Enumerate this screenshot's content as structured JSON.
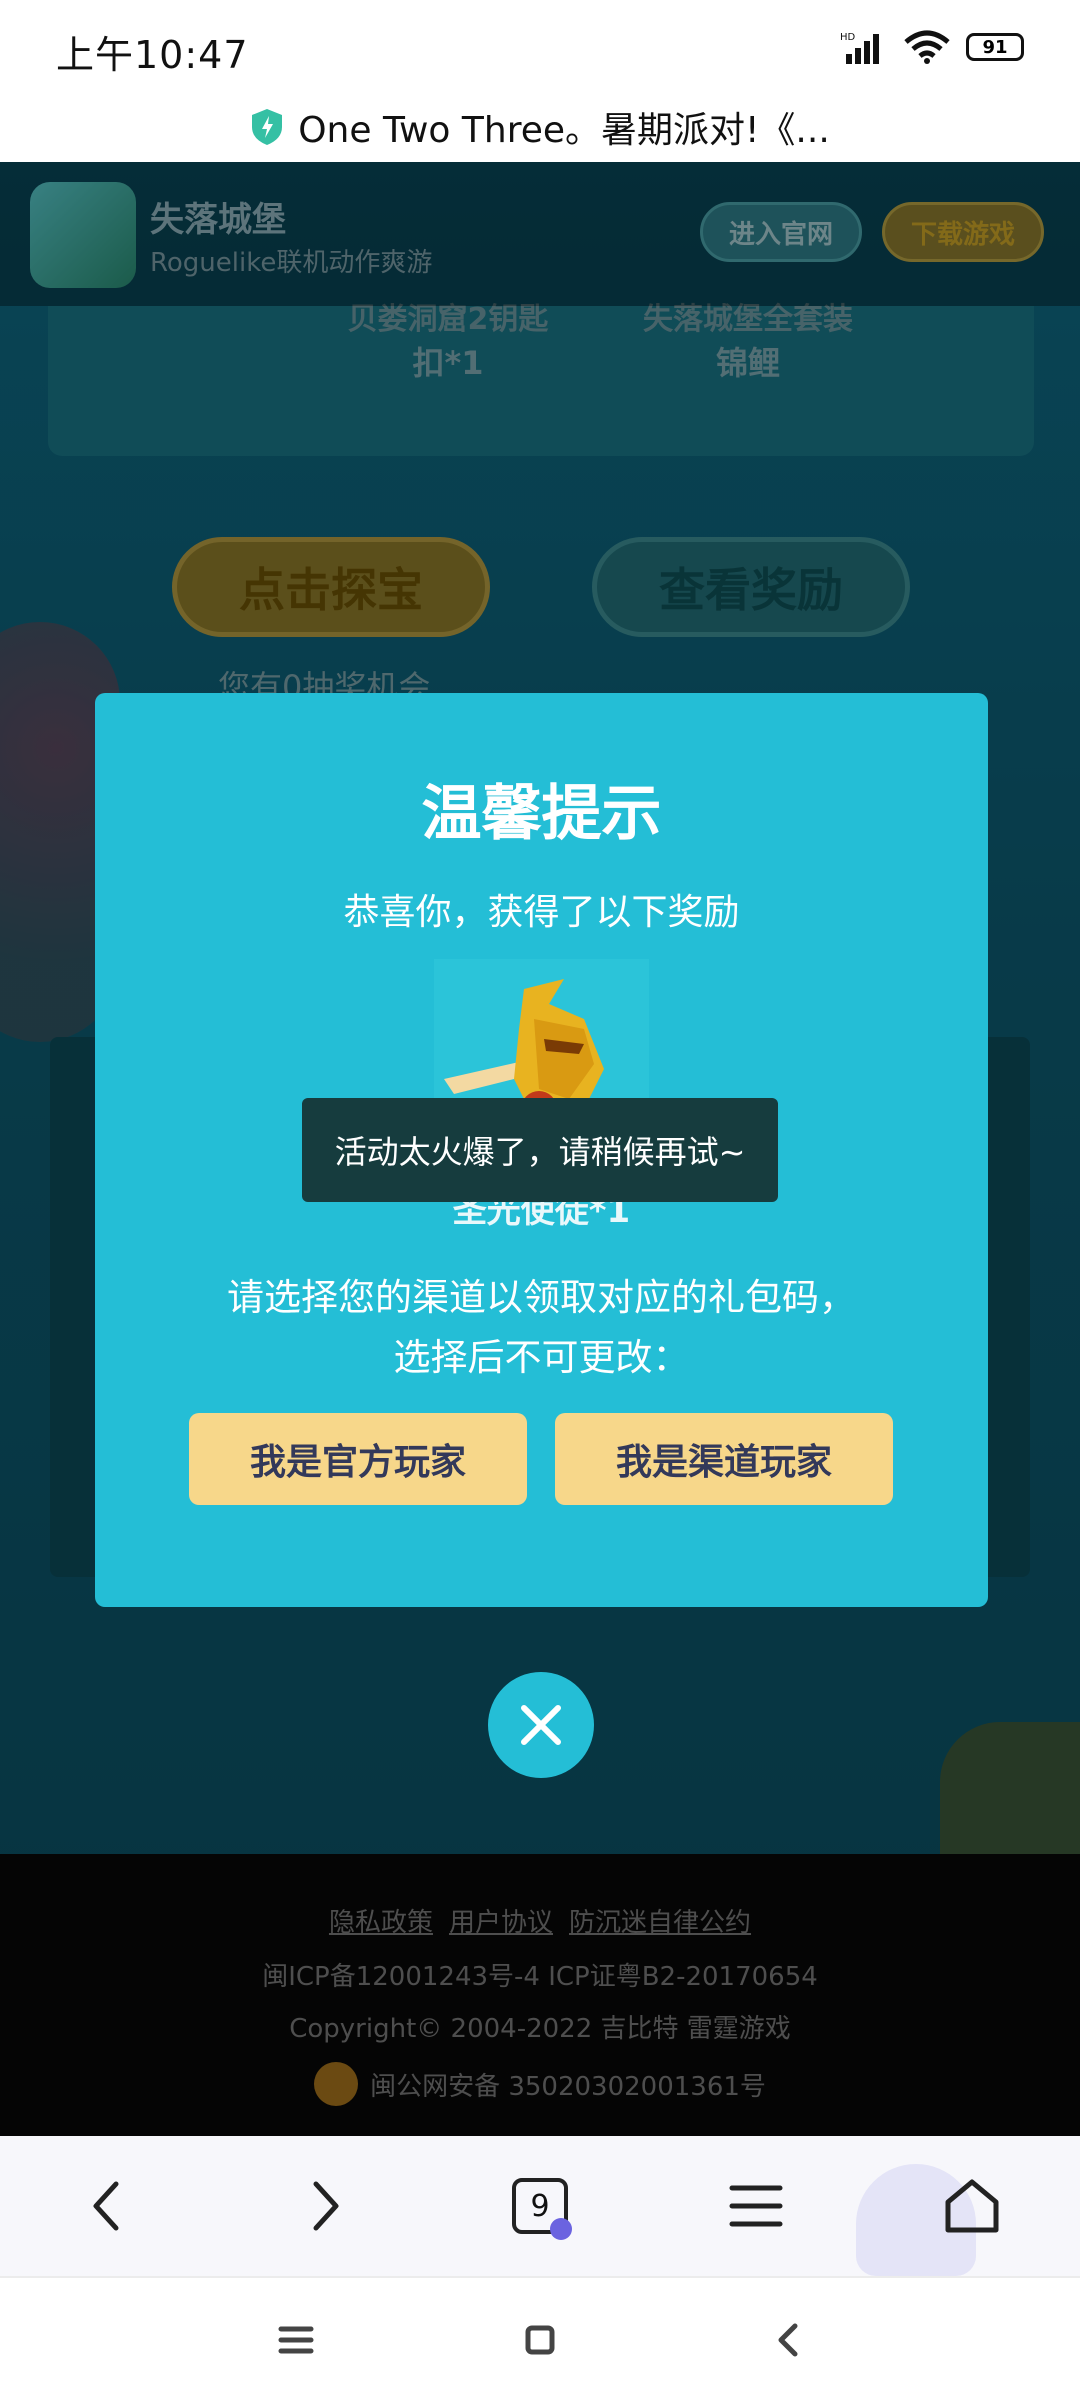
{
  "status_bar": {
    "time": "上午10:47",
    "signal_label": "HD",
    "battery_label": "91"
  },
  "url_bar": {
    "title": "One Two Three。暑期派对!《..."
  },
  "game_header": {
    "app_name": "失落城堡",
    "tagline": "Roguelike联机动作爽游",
    "official_btn": "进入官网",
    "download_btn": "下载游戏"
  },
  "reward_card": {
    "item1_line1": "贝娄洞窟2钥匙",
    "item1_line2": "扣*1",
    "item2_line1": "失落城堡全套装",
    "item2_line2": "锦鲤"
  },
  "actions": {
    "treasure_btn": "点击探宝",
    "view_btn": "查看奖励",
    "chances": "您有0抽奖机会"
  },
  "modal": {
    "title": "温馨提示",
    "subtitle": "恭喜你，获得了以下奖励",
    "prize_name": "圣光使徒*1",
    "prompt_line1": "请选择您的渠道以领取对应的礼包码，",
    "prompt_line2": "选择后不可更改：",
    "official_player": "我是官方玩家",
    "channel_player": "我是渠道玩家"
  },
  "toast": {
    "text": "活动太火爆了，请稍候再试~"
  },
  "footer": {
    "links": [
      "隐私政策",
      "用户协议",
      "防沉迷自律公约"
    ],
    "icp": "闽ICP备12001243号-4  ICP证粤B2-20170654",
    "copyright": "Copyright© 2004-2022  吉比特  雷霆游戏",
    "police": "闽公网安备 35020302001361号"
  },
  "toolbar": {
    "tab_count": "9"
  },
  "colors": {
    "modal_bg": "#24bed6",
    "choice_bg": "#f7d78a",
    "choice_text": "#33395a",
    "toast_bg": "#163c3e"
  }
}
